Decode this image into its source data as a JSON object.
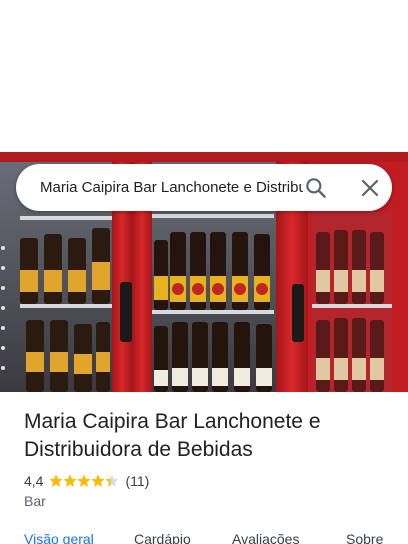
{
  "search": {
    "query": "Maria Caipira Bar Lanchonete e Distribuidora de Bebidas"
  },
  "place": {
    "name": "Maria Caipira Bar Lanchonete e Distribuidora de Bebidas",
    "rating": "4,4",
    "rating_stars": 4.4,
    "review_count": "(11)",
    "category": "Bar"
  },
  "tabs": [
    {
      "label": "Visão geral",
      "active": true
    },
    {
      "label": "Cardápio",
      "active": false
    },
    {
      "label": "Avaliações",
      "active": false
    },
    {
      "label": "Sobre",
      "active": false
    }
  ],
  "colors": {
    "accent": "#1a73e8",
    "star": "#fbbc04",
    "fridge_red": "#c8201e"
  },
  "icons": [
    "search-icon",
    "close-icon",
    "star-icon"
  ]
}
